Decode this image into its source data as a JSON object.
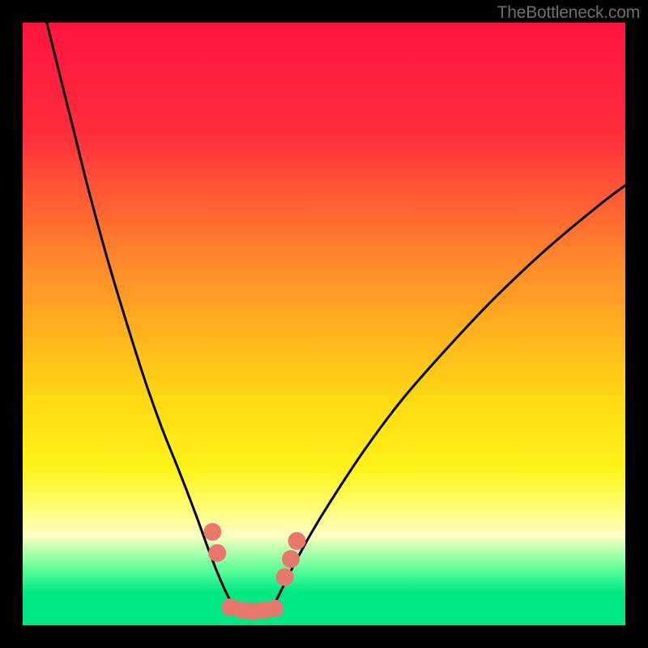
{
  "attribution": "TheBottleneck.com",
  "chart_data": {
    "type": "line",
    "title": "",
    "xlabel": "",
    "ylabel": "",
    "ylim": [
      0,
      100
    ],
    "xlim": [
      0,
      100
    ],
    "gradient_stops": [
      {
        "offset": 0.0,
        "color": "#ff153f"
      },
      {
        "offset": 0.18,
        "color": "#ff2d3d"
      },
      {
        "offset": 0.4,
        "color": "#ff8a2b"
      },
      {
        "offset": 0.62,
        "color": "#ffd714"
      },
      {
        "offset": 0.74,
        "color": "#fff31a"
      },
      {
        "offset": 0.8,
        "color": "#fffd6d"
      },
      {
        "offset": 0.85,
        "color": "#ffffc2"
      },
      {
        "offset": 0.905,
        "color": "#65ff9a"
      },
      {
        "offset": 0.945,
        "color": "#00e884"
      },
      {
        "offset": 1.0,
        "color": "#00e884"
      }
    ],
    "series": [
      {
        "name": "left-curve",
        "x": [
          4.0,
          6.0,
          8.5,
          11.0,
          14.0,
          17.0,
          20.0,
          23.0,
          26.0,
          28.5,
          30.5,
          32.0,
          33.5,
          35.0
        ],
        "y": [
          100.0,
          92.0,
          82.0,
          72.0,
          61.0,
          51.0,
          41.5,
          33.0,
          25.5,
          19.0,
          13.5,
          9.5,
          6.0,
          3.0
        ]
      },
      {
        "name": "right-curve",
        "x": [
          41.5,
          43.0,
          45.0,
          48.0,
          52.0,
          57.0,
          63.0,
          70.0,
          78.0,
          87.0,
          96.0,
          100.0
        ],
        "y": [
          3.0,
          6.0,
          10.0,
          15.5,
          22.0,
          29.5,
          37.5,
          45.5,
          54.0,
          62.5,
          70.0,
          73.0
        ]
      }
    ],
    "good_band_y": [
      0.0,
      3.0
    ],
    "markers": {
      "color": "#e8786d",
      "radius": 11,
      "points": [
        {
          "x": 31.5,
          "y": 15.5
        },
        {
          "x": 32.3,
          "y": 12.0
        },
        {
          "x": 34.5,
          "y": 3.0
        },
        {
          "x": 36.5,
          "y": 2.5
        },
        {
          "x": 38.3,
          "y": 2.3
        },
        {
          "x": 40.0,
          "y": 2.5
        },
        {
          "x": 41.8,
          "y": 2.8
        },
        {
          "x": 43.5,
          "y": 8.0
        },
        {
          "x": 44.5,
          "y": 11.0
        },
        {
          "x": 45.5,
          "y": 14.0
        }
      ]
    }
  }
}
